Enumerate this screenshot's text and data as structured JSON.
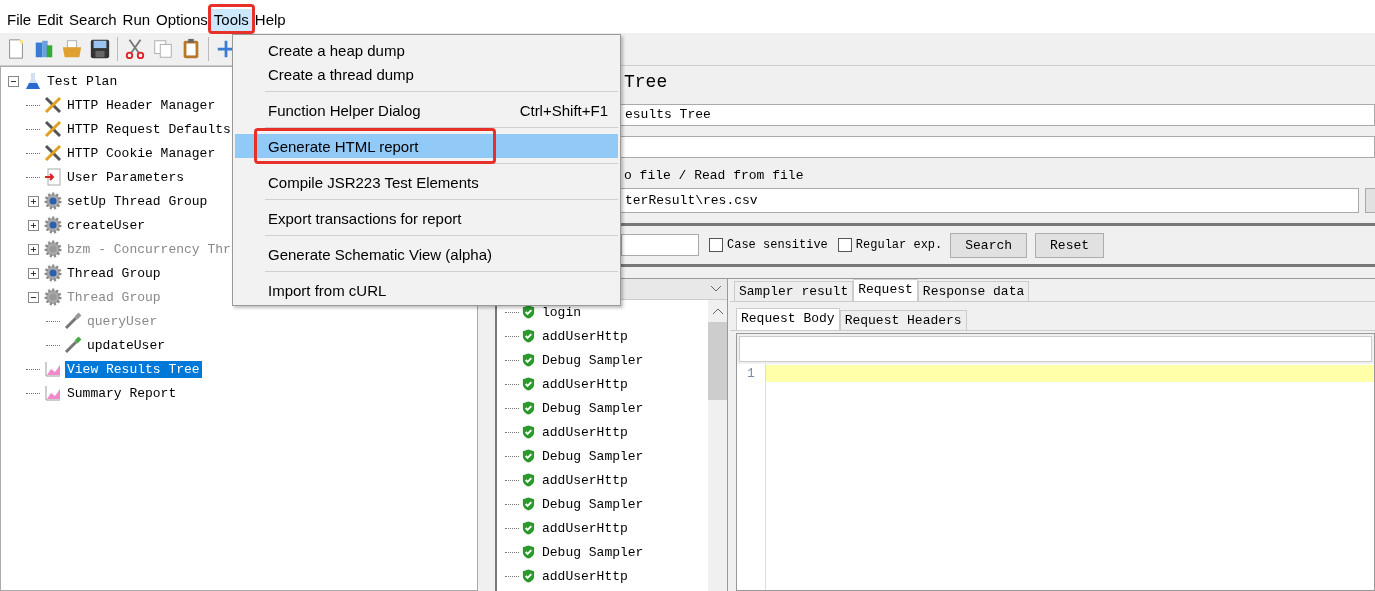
{
  "menubar": [
    {
      "label": "File",
      "open": false,
      "annotated": false
    },
    {
      "label": "Edit",
      "open": false,
      "annotated": false
    },
    {
      "label": "Search",
      "open": false,
      "annotated": false
    },
    {
      "label": "Run",
      "open": false,
      "annotated": false
    },
    {
      "label": "Options",
      "open": false,
      "annotated": false
    },
    {
      "label": "Tools",
      "open": true,
      "annotated": true
    },
    {
      "label": "Help",
      "open": false,
      "annotated": false
    }
  ],
  "tools_menu": {
    "groups": [
      [
        {
          "label": "Create a heap dump",
          "selected": false,
          "annotated": false
        },
        {
          "label": "Create a thread dump",
          "selected": false,
          "annotated": false
        }
      ],
      [
        {
          "label": "Function Helper Dialog",
          "shortcut": "Ctrl+Shift+F1",
          "selected": false,
          "annotated": false
        }
      ],
      [
        {
          "label": "Generate HTML report",
          "selected": true,
          "annotated": true
        }
      ],
      [
        {
          "label": "Compile JSR223 Test Elements",
          "selected": false,
          "annotated": false
        }
      ],
      [
        {
          "label": "Export transactions for report",
          "selected": false,
          "annotated": false
        }
      ],
      [
        {
          "label": "Generate Schematic View (alpha)",
          "selected": false,
          "annotated": false
        }
      ],
      [
        {
          "label": "Import from cURL",
          "selected": false,
          "annotated": false
        }
      ]
    ]
  },
  "tree": [
    {
      "label": "Test Plan",
      "kind": "flask",
      "expanded": true,
      "selected": false,
      "disabled": false,
      "children": [
        {
          "label": "HTTP Header Manager",
          "kind": "tools",
          "selected": false,
          "disabled": false
        },
        {
          "label": "HTTP Request Defaults",
          "kind": "tools",
          "selected": false,
          "disabled": false
        },
        {
          "label": "HTTP Cookie Manager",
          "kind": "tools",
          "selected": false,
          "disabled": false
        },
        {
          "label": "User Parameters",
          "kind": "params",
          "selected": false,
          "disabled": false
        },
        {
          "label": "setUp Thread Group",
          "kind": "gear",
          "expanded": false,
          "selected": false,
          "disabled": false
        },
        {
          "label": "createUser",
          "kind": "gear",
          "expanded": false,
          "selected": false,
          "disabled": false
        },
        {
          "label": "bzm - Concurrency Thr",
          "kind": "gear",
          "expanded": false,
          "selected": false,
          "disabled": true
        },
        {
          "label": "Thread Group",
          "kind": "gear",
          "expanded": false,
          "selected": false,
          "disabled": false
        },
        {
          "label": "Thread Group",
          "kind": "gear",
          "expanded": true,
          "selected": false,
          "disabled": true,
          "children": [
            {
              "label": "queryUser",
              "kind": "pipette",
              "selected": false,
              "disabled": true
            },
            {
              "label": "updateUser",
              "kind": "pipette",
              "selected": false,
              "disabled": false
            }
          ]
        },
        {
          "label": "View Results Tree",
          "kind": "graph",
          "selected": true,
          "disabled": false
        },
        {
          "label": "Summary Report",
          "kind": "graph",
          "selected": false,
          "disabled": false
        }
      ]
    }
  ],
  "panel": {
    "title": "Tree",
    "name_value": "esults Tree",
    "file_group_label": "o file / Read from file",
    "filename_value": "terResult\\res.csv",
    "search_options": [
      {
        "label": "Case sensitive",
        "checked": false
      },
      {
        "label": "Regular exp.",
        "checked": false
      }
    ],
    "search_buttons": [
      "Search",
      "Reset"
    ],
    "results": [
      "login",
      "addUserHttp",
      "Debug Sampler",
      "addUserHttp",
      "Debug Sampler",
      "addUserHttp",
      "Debug Sampler",
      "addUserHttp",
      "Debug Sampler",
      "addUserHttp",
      "Debug Sampler",
      "addUserHttp"
    ],
    "result_tabs": [
      {
        "label": "Sampler result",
        "selected": false
      },
      {
        "label": "Request",
        "selected": true
      },
      {
        "label": "Response data",
        "selected": false
      }
    ],
    "request_tabs": [
      {
        "label": "Request Body",
        "selected": true
      },
      {
        "label": "Request Headers",
        "selected": false
      }
    ],
    "line_numbers": [
      "1"
    ]
  }
}
